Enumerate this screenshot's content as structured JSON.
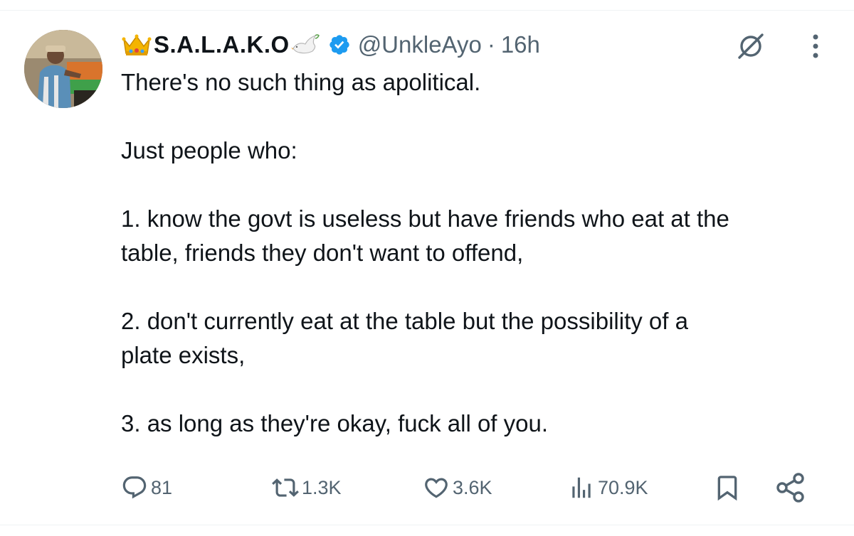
{
  "tweet": {
    "author": {
      "display_name": "S.A.L.A.K.O",
      "handle": "@UnkleAyo",
      "separator": "·",
      "time": "16h",
      "verified": true,
      "name_emojis": [
        "crown-icon",
        "dove-icon"
      ]
    },
    "text_lines": [
      "There's no such thing as apolitical.",
      "",
      "Just people who:",
      "",
      "1. know the govt is useless but have friends who eat at the",
      "table, friends they don't want to offend,",
      "",
      "2. don't currently eat at the table but the possibility of a",
      "plate exists,",
      "",
      "3. as long as they're okay, fuck all of you."
    ],
    "stats": {
      "replies": "81",
      "reposts": "1.3K",
      "likes": "3.6K",
      "views": "70.9K"
    }
  },
  "header_actions": {
    "grok_icon": "grok-icon",
    "more_icon": "more-vertical-icon"
  },
  "colors": {
    "text_primary": "#0f1419",
    "text_secondary": "#536471",
    "verified_blue": "#1d9bf0",
    "divider": "#eff3f4"
  }
}
